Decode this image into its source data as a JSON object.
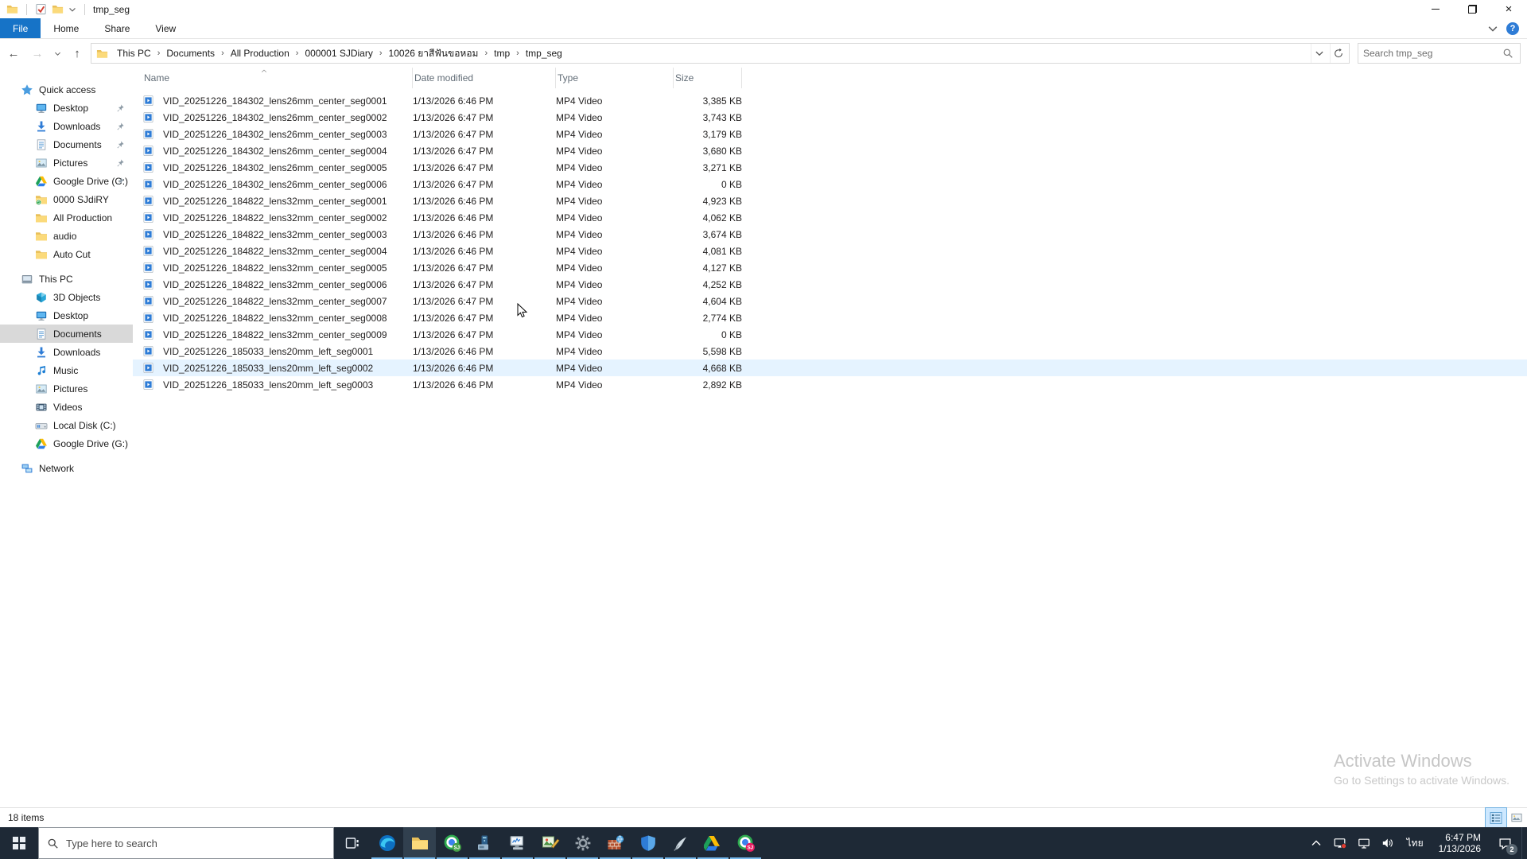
{
  "colors": {
    "accent": "#1673c7",
    "row_hover": "#e5f3ff",
    "sidebar_selected": "#d9d9d9",
    "taskbar_bg": "#1e2936",
    "taskbar_underline": "#76b9ed",
    "watermark": "#c6c6c6"
  },
  "window": {
    "title": "tmp_seg",
    "qat_icons": [
      "app-folder",
      "properties",
      "new-folder",
      "customize-arrow"
    ],
    "controls": {
      "minimize": "minimize",
      "restore": "restore",
      "close": "close"
    }
  },
  "ribbon": {
    "tabs": [
      "File",
      "Home",
      "Share",
      "View"
    ],
    "right_icons": [
      "collapse-ribbon-chevron",
      "help"
    ],
    "help_glyph": "?"
  },
  "nav": {
    "back": "back",
    "forward": "forward",
    "recent": "recent-locations",
    "up": "up"
  },
  "address": {
    "crumbs": [
      "This PC",
      "Documents",
      "All Production",
      "000001 SJDiary",
      "10026 ยาสีฟันขอหอม",
      "tmp",
      "tmp_seg"
    ],
    "separator": "›"
  },
  "search": {
    "placeholder": "Search tmp_seg"
  },
  "columns": [
    {
      "label": "Name",
      "sort": "asc"
    },
    {
      "label": "Date modified"
    },
    {
      "label": "Type"
    },
    {
      "label": "Size"
    }
  ],
  "files": [
    {
      "name": "VID_20251226_184302_lens26mm_center_seg0001",
      "date": "1/13/2026 6:46 PM",
      "type": "MP4 Video",
      "size": "3,385 KB"
    },
    {
      "name": "VID_20251226_184302_lens26mm_center_seg0002",
      "date": "1/13/2026 6:47 PM",
      "type": "MP4 Video",
      "size": "3,743 KB"
    },
    {
      "name": "VID_20251226_184302_lens26mm_center_seg0003",
      "date": "1/13/2026 6:47 PM",
      "type": "MP4 Video",
      "size": "3,179 KB"
    },
    {
      "name": "VID_20251226_184302_lens26mm_center_seg0004",
      "date": "1/13/2026 6:47 PM",
      "type": "MP4 Video",
      "size": "3,680 KB"
    },
    {
      "name": "VID_20251226_184302_lens26mm_center_seg0005",
      "date": "1/13/2026 6:47 PM",
      "type": "MP4 Video",
      "size": "3,271 KB"
    },
    {
      "name": "VID_20251226_184302_lens26mm_center_seg0006",
      "date": "1/13/2026 6:47 PM",
      "type": "MP4 Video",
      "size": "0 KB"
    },
    {
      "name": "VID_20251226_184822_lens32mm_center_seg0001",
      "date": "1/13/2026 6:46 PM",
      "type": "MP4 Video",
      "size": "4,923 KB"
    },
    {
      "name": "VID_20251226_184822_lens32mm_center_seg0002",
      "date": "1/13/2026 6:46 PM",
      "type": "MP4 Video",
      "size": "4,062 KB"
    },
    {
      "name": "VID_20251226_184822_lens32mm_center_seg0003",
      "date": "1/13/2026 6:46 PM",
      "type": "MP4 Video",
      "size": "3,674 KB"
    },
    {
      "name": "VID_20251226_184822_lens32mm_center_seg0004",
      "date": "1/13/2026 6:46 PM",
      "type": "MP4 Video",
      "size": "4,081 KB"
    },
    {
      "name": "VID_20251226_184822_lens32mm_center_seg0005",
      "date": "1/13/2026 6:47 PM",
      "type": "MP4 Video",
      "size": "4,127 KB"
    },
    {
      "name": "VID_20251226_184822_lens32mm_center_seg0006",
      "date": "1/13/2026 6:47 PM",
      "type": "MP4 Video",
      "size": "4,252 KB"
    },
    {
      "name": "VID_20251226_184822_lens32mm_center_seg0007",
      "date": "1/13/2026 6:47 PM",
      "type": "MP4 Video",
      "size": "4,604 KB"
    },
    {
      "name": "VID_20251226_184822_lens32mm_center_seg0008",
      "date": "1/13/2026 6:47 PM",
      "type": "MP4 Video",
      "size": "2,774 KB"
    },
    {
      "name": "VID_20251226_184822_lens32mm_center_seg0009",
      "date": "1/13/2026 6:47 PM",
      "type": "MP4 Video",
      "size": "0 KB"
    },
    {
      "name": "VID_20251226_185033_lens20mm_left_seg0001",
      "date": "1/13/2026 6:46 PM",
      "type": "MP4 Video",
      "size": "5,598 KB"
    },
    {
      "name": "VID_20251226_185033_lens20mm_left_seg0002",
      "date": "1/13/2026 6:46 PM",
      "type": "MP4 Video",
      "size": "4,668 KB",
      "hover": true
    },
    {
      "name": "VID_20251226_185033_lens20mm_left_seg0003",
      "date": "1/13/2026 6:46 PM",
      "type": "MP4 Video",
      "size": "2,892 KB"
    }
  ],
  "sidebar": {
    "sections": [
      {
        "label": "Quick access",
        "icon": "star",
        "items": [
          {
            "label": "Desktop",
            "icon": "monitor",
            "pinned": true
          },
          {
            "label": "Downloads",
            "icon": "download",
            "pinned": true
          },
          {
            "label": "Documents",
            "icon": "document",
            "pinned": true
          },
          {
            "label": "Pictures",
            "icon": "picture",
            "pinned": true
          },
          {
            "label": "Google Drive (G:)",
            "icon": "gdrive",
            "pinned": true
          },
          {
            "label": "0000 SJdiRY",
            "icon": "folder-sync"
          },
          {
            "label": "All Production",
            "icon": "folder"
          },
          {
            "label": "audio",
            "icon": "folder"
          },
          {
            "label": "Auto Cut",
            "icon": "folder"
          }
        ]
      },
      {
        "label": "This PC",
        "icon": "pc",
        "items": [
          {
            "label": "3D Objects",
            "icon": "cube"
          },
          {
            "label": "Desktop",
            "icon": "monitor"
          },
          {
            "label": "Documents",
            "icon": "document",
            "selected": true
          },
          {
            "label": "Downloads",
            "icon": "download"
          },
          {
            "label": "Music",
            "icon": "music"
          },
          {
            "label": "Pictures",
            "icon": "picture"
          },
          {
            "label": "Videos",
            "icon": "video"
          },
          {
            "label": "Local Disk (C:)",
            "icon": "disk"
          },
          {
            "label": "Google Drive (G:)",
            "icon": "gdrive"
          }
        ]
      },
      {
        "label": "Network",
        "icon": "network",
        "items": []
      }
    ]
  },
  "statusbar": {
    "items_count": "18 items",
    "view_toggles": [
      "details-view",
      "thumbnail-view"
    ]
  },
  "watermark": {
    "title": "Activate Windows",
    "subtitle": "Go to Settings to activate Windows."
  },
  "taskbar": {
    "search_placeholder": "Type here to search",
    "apps": [
      {
        "icon": "edge"
      },
      {
        "icon": "explorer",
        "active": true
      },
      {
        "icon": "chrome",
        "badge": "SJ",
        "badge_color": "#43a047"
      },
      {
        "icon": "pc-tower"
      },
      {
        "icon": "system-monitor"
      },
      {
        "icon": "image-editor"
      },
      {
        "icon": "settings-gear"
      },
      {
        "icon": "firewall"
      },
      {
        "icon": "defender-shield"
      },
      {
        "icon": "feather-pen"
      },
      {
        "icon": "google-drive"
      },
      {
        "icon": "chrome",
        "badge": "SJ",
        "badge_color": "#e91e63"
      }
    ],
    "tray": {
      "icons": [
        "chevron-up",
        "screen-record",
        "network-display",
        "volume"
      ],
      "language": "ไทย",
      "time": "6:47 PM",
      "date": "1/13/2026",
      "notification_badge": "2"
    }
  }
}
